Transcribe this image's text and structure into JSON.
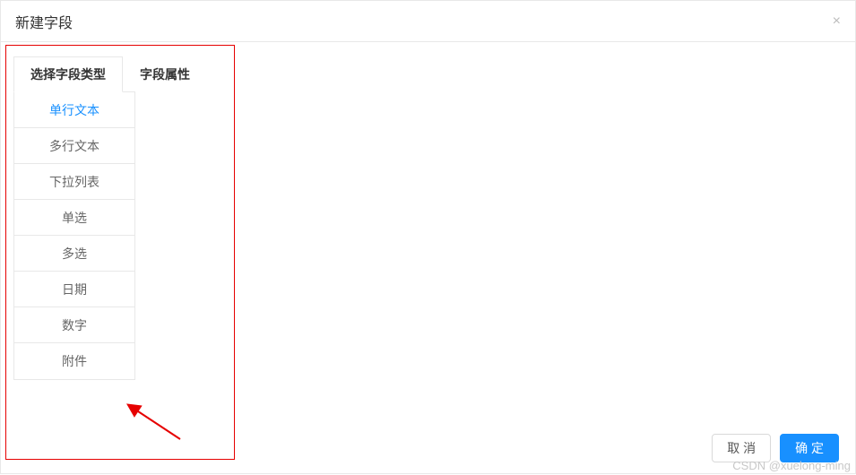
{
  "modal": {
    "title": "新建字段",
    "close_label": "×"
  },
  "tabs": {
    "items": [
      {
        "label": "选择字段类型",
        "active": true
      },
      {
        "label": "字段属性",
        "active": false
      }
    ]
  },
  "field_types": {
    "items": [
      {
        "label": "单行文本",
        "selected": true
      },
      {
        "label": "多行文本",
        "selected": false
      },
      {
        "label": "下拉列表",
        "selected": false
      },
      {
        "label": "单选",
        "selected": false
      },
      {
        "label": "多选",
        "selected": false
      },
      {
        "label": "日期",
        "selected": false
      },
      {
        "label": "数字",
        "selected": false
      },
      {
        "label": "附件",
        "selected": false
      }
    ]
  },
  "footer": {
    "cancel_label": "取 消",
    "confirm_label": "确 定"
  },
  "watermark": "CSDN @xuelong-ming"
}
